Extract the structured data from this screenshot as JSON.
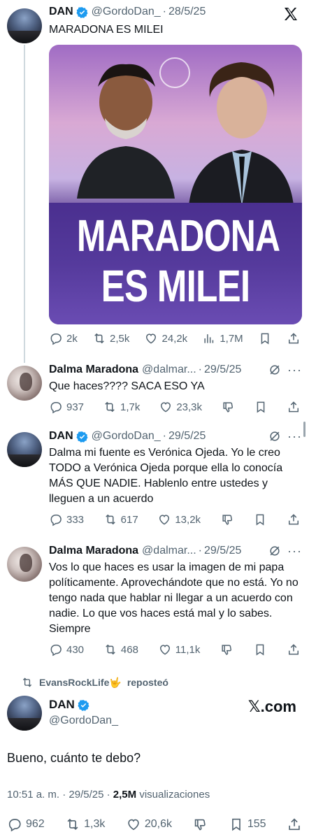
{
  "colors": {
    "text": "#0f1419",
    "muted": "#536471",
    "verified": "#1d9bf0",
    "thread_line": "#cfd9de"
  },
  "tweet1": {
    "name": "DAN",
    "handle": "@GordoDan_",
    "date": "28/5/25",
    "text": "MARADONA ES MILEI",
    "image_text_line1": "MARADONA",
    "image_text_line2": "ES MILEI",
    "replies": "2k",
    "reposts": "2,5k",
    "likes": "24,2k",
    "views": "1,7M"
  },
  "tweet2": {
    "name": "Dalma Maradona",
    "handle": "@dalmar...",
    "date": "29/5/25",
    "text": "Que haces???? SACA ESO YA",
    "replies": "937",
    "reposts": "1,7k",
    "likes": "23,3k"
  },
  "tweet3": {
    "name": "DAN",
    "handle": "@GordoDan_",
    "date": "29/5/25",
    "text": "Dalma mi fuente es Verónica Ojeda. Yo le creo TODO a Verónica Ojeda porque ella lo conocía MÁS QUE NADIE. Hablenlo entre ustedes y lleguen a un acuerdo",
    "replies": "333",
    "reposts": "617",
    "likes": "13,2k"
  },
  "tweet4": {
    "name": "Dalma Maradona",
    "handle": "@dalmar...",
    "date": "29/5/25",
    "text": "Vos lo que haces es usar la imagen de mi papa políticamente. Aprovechándote que no está. Yo no tengo nada que hablar ni llegar a un acuerdo con nadie. Lo que vos haces está mal y lo sabes. Siempre",
    "replies": "430",
    "reposts": "468",
    "likes": "11,1k"
  },
  "repost_notice": {
    "user": "EvansRockLife🤟",
    "label": "reposteó"
  },
  "main_tweet": {
    "name": "DAN",
    "handle": "@GordoDan_",
    "brand": "𝕏.com",
    "text": "Bueno, cuánto te debo?",
    "time": "10:51 a. m.",
    "date": "29/5/25",
    "views": "2,5M",
    "views_label": "visualizaciones",
    "replies": "962",
    "reposts": "1,3k",
    "likes": "20,6k",
    "bookmarks": "155"
  }
}
